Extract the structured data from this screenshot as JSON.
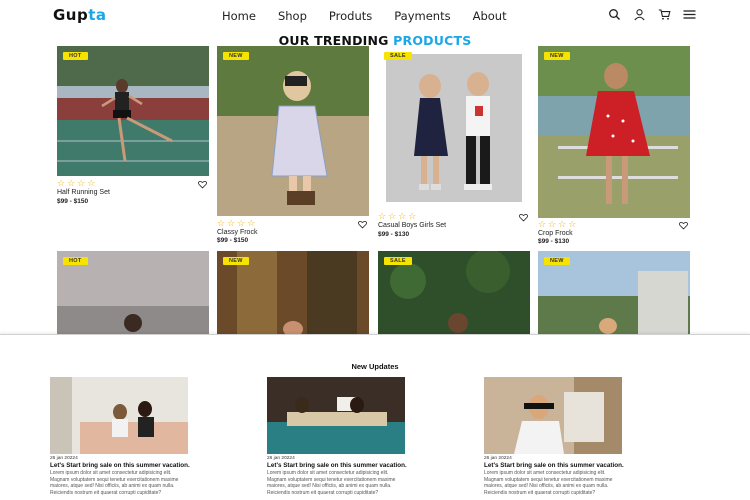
{
  "brand": {
    "name_main": "Gup",
    "name_accent": "ta"
  },
  "nav": {
    "items": [
      "Home",
      "Shop",
      "Produts",
      "Payments",
      "About"
    ]
  },
  "icons": [
    "search-icon",
    "user-icon",
    "cart-icon",
    "menu-icon"
  ],
  "heading": {
    "main": "OUR TRENDING ",
    "accent": "PRODUCTS"
  },
  "products": [
    {
      "badge": "HOT",
      "stars": "☆☆☆☆",
      "title": "Half Running Set",
      "price": "$99 - $150"
    },
    {
      "badge": "NEW",
      "stars": "☆☆☆☆",
      "title": "Classy Frock",
      "price": "$99 - $150"
    },
    {
      "badge": "SALE",
      "stars": "☆☆☆☆",
      "title": "Casual Boys Girls Set",
      "price": "$99 - $130"
    },
    {
      "badge": "NEW",
      "stars": "☆☆☆☆",
      "title": "Crop Frock",
      "price": "$99 - $130"
    },
    {
      "badge": "HOT"
    },
    {
      "badge": "NEW"
    },
    {
      "badge": "SALE"
    },
    {
      "badge": "NEW"
    }
  ],
  "updates": {
    "title": "New Updates",
    "posts": [
      {
        "date": "26 jan 20224",
        "title": "Let's Start bring sale on this summer vacation.",
        "body": "Lorem ipsum dolor sit amet consectetur adipisicing elit. Magnam voluptatem sequi tenetur exercitationem maxime maiores, atque sed! Nisi officiis, ab animi ex quam nulla. Reiciendis nostrum eit quaerat corrupti cupiditate?"
      },
      {
        "date": "26 jan 20224",
        "title": "Let's Start bring sale on this summer vacation.",
        "body": "Lorem ipsum dolor sit amet consectetur adipisicing elit. Magnam voluptatem sequi tenetur exercitationem maxime maiores, atque sed! Nisi officiis, ab animi ex quam nulla. Reiciendis nostrum eit quaerat corrupti cupiditate?"
      },
      {
        "date": "26 jan 20224",
        "title": "Let's Start bring sale on this summer vacation.",
        "body": "Lorem ipsum dolor sit amet consectetur adipisicing elit. Magnam voluptatem sequi tenetur exercitationem maxime maiores, atque sed! Nisi officiis, ab animi ex quam nulla. Reiciendis nostrum eit quaerat corrupti cupiditate?"
      }
    ]
  },
  "colors": {
    "accent": "#1aa7e8",
    "badge": "#f6e400",
    "star": "#f2b100"
  }
}
